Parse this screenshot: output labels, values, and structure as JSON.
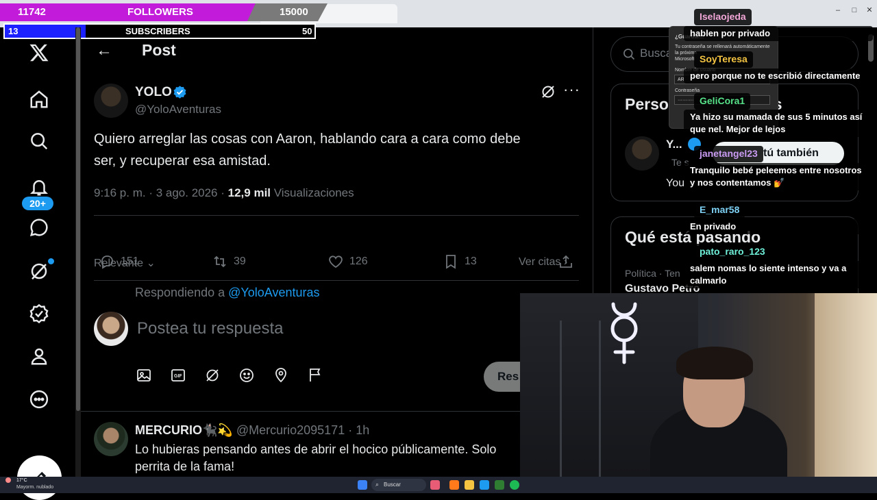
{
  "overlay": {
    "followers": {
      "current": "11742",
      "label": "FOLLOWERS",
      "goal": "15000",
      "progress": 0.78
    },
    "subscribers": {
      "current": "13",
      "label": "SUBSCRIBERS",
      "goal": "50",
      "progress": 0.26
    }
  },
  "nav": {
    "notifications_badge": "20+",
    "icons": [
      "x-logo-icon",
      "home-icon",
      "search-icon",
      "bell-icon",
      "messages-icon",
      "grok-icon",
      "verified-icon",
      "profile-icon",
      "more-icon",
      "compose-icon"
    ]
  },
  "post": {
    "header_title": "Post",
    "author_name": "YOLO",
    "author_handle": "@YoloAventuras",
    "text_line1": "Quiero arreglar las cosas con Aaron, hablando cara a cara como debe",
    "text_line2": "ser, y recuperar esa amistad.",
    "timestamp": "9:16 p. m. · 3 ago. 2026 ·",
    "views_count": "12,9 mil",
    "views_label": "Visualizaciones",
    "stats": {
      "replies": "151",
      "reposts": "39",
      "likes": "126",
      "bookmarks": "13"
    },
    "sort_label": "Relevante",
    "quotes_label": "Ver citas"
  },
  "reply_box": {
    "replying_prefix": "Respondiendo a",
    "replying_handle": "@YoloAventuras",
    "placeholder": "Postea tu respuesta",
    "submit_label": "Res"
  },
  "reply": {
    "author_name": "MERCURIO🐈‍⬛💫",
    "author_handle": "@Mercurio2095171",
    "time": "· 1h",
    "text_line1": "Lo hubieras pensando antes de abrir el hocico públicamente. Solo",
    "text_line2": "perrita de la fama!"
  },
  "right_col": {
    "search_placeholder": "Busca",
    "who_to_follow_title": "Perso",
    "who_to_follow_title_end": "es",
    "follow_user_name": "Y...",
    "follow_user_sub": "Te s",
    "follow_button": "tú también",
    "follow_desc": "You",
    "trending_title": "Qué está pasando",
    "trend_category": "Política · Ten",
    "trend_name": "Gustavo Petro"
  },
  "password_popup": {
    "title": "¿Guardar...",
    "desc1": "Tu contraseña se rellenará automáticamente",
    "desc2": "la próxima",
    "desc3": "Microsoft",
    "user_label": "Nombre de usuario",
    "user_value": "AR",
    "pass_label": "Contraseña",
    "pass_value": "··········"
  },
  "chat": [
    {
      "user": "Iselaojeda",
      "color": "#f2a7d8",
      "message": "hablen por privado"
    },
    {
      "user": "SoyTeresa",
      "color": "#f5c542",
      "message": "pero porque no te escribió directamente"
    },
    {
      "user": "GeliCora1",
      "color": "#57e389",
      "message": "Ya hizo su mamada de sus 5 minutos así que nel. Mejor de lejos"
    },
    {
      "user": "janetangel23",
      "color": "#c99bf2",
      "message": "Tranquilo bebé peleemos entre nosotros y nos contentamos 💅"
    },
    {
      "user": "E_mar58",
      "color": "#7fd3f7",
      "message": "En privado"
    },
    {
      "user": "pato_raro_123",
      "color": "#6ff0d9",
      "message": "salem nomas lo siente intenso y va a calmarlo"
    }
  ],
  "taskbar": {
    "weather_temp": "17°C",
    "weather_desc": "Mayorm. nublado",
    "search_label": "Buscar"
  },
  "colors": {
    "accent": "#1d9bf0",
    "followers_fill": "#c21bd9",
    "subs_fill": "#1b22ff",
    "background": "#000000"
  }
}
